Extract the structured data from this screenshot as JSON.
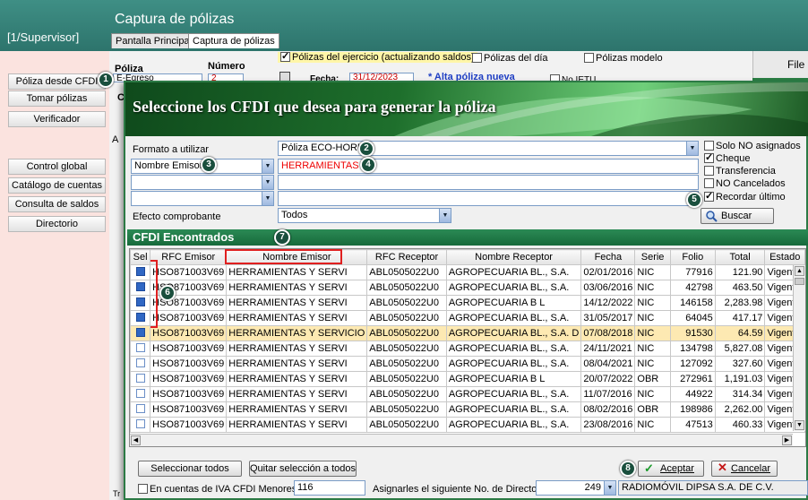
{
  "app": {
    "title": "Captura de pólizas",
    "user": "[1/Supervisor]"
  },
  "tabs": [
    "Pantalla Principal",
    "Captura de pólizas"
  ],
  "sidebar": {
    "items": [
      "Póliza desde CFDI",
      "Tomar pólizas",
      "Verificador",
      "Control global",
      "Catálogo de cuentas",
      "Consulta de saldos",
      "Directorio"
    ]
  },
  "background_form": {
    "poliza_label": "Póliza",
    "numero_label": "Número",
    "poliza_value": "E-Egreso",
    "numero_value": "2",
    "fecha_label": "Fecha:",
    "fecha_value": "31/12/2023",
    "alta_link": "* Alta póliza nueva",
    "no_ietu": "No IETU",
    "checks": [
      {
        "label": "Pólizas del ejercicio (actualizando saldos)",
        "checked": true
      },
      {
        "label": "Pólizas del día",
        "checked": false
      },
      {
        "label": "Pólizas modelo",
        "checked": false
      }
    ],
    "file_menu": "File",
    "left_letter_c": "C",
    "left_letter_a": "A",
    "bottom_letter": "Tr"
  },
  "dialog": {
    "title": "Seleccione los CFDI que desea para generar la póliza",
    "formato_label": "Formato a utilizar",
    "formato_value": "Póliza ECO-HORU",
    "filter1_field": "Nombre Emisor",
    "filter1_value": "HERRAMIENTAS",
    "efecto_label": "Efecto comprobante",
    "efecto_value": "Todos",
    "options": [
      {
        "label": "Solo NO asignados",
        "checked": false
      },
      {
        "label": "Cheque",
        "checked": true
      },
      {
        "label": "Transferencia",
        "checked": false
      },
      {
        "label": "NO Cancelados",
        "checked": false
      },
      {
        "label": "Recordar último",
        "checked": true
      }
    ],
    "buscar_label": "Buscar",
    "cfdi_header": "CFDI Encontrados",
    "columns": [
      "Sel",
      "RFC Emisor",
      "Nombre Emisor",
      "RFC Receptor",
      "Nombre Receptor",
      "Fecha",
      "Serie",
      "Folio",
      "Total",
      "Estado"
    ],
    "rows": [
      {
        "sel": true,
        "rfc_emisor": "HSO871003V69",
        "nombre_emisor": "HERRAMIENTAS Y SERVI",
        "rfc_receptor": "ABL0505022U0",
        "nombre_receptor": "AGROPECUARIA BL., S.A.",
        "fecha": "02/01/2016",
        "serie": "NIC",
        "folio": "77916",
        "total": "121.90",
        "estado": "Vigente"
      },
      {
        "sel": true,
        "rfc_emisor": "HSO871003V69",
        "nombre_emisor": "HERRAMIENTAS Y SERVI",
        "rfc_receptor": "ABL0505022U0",
        "nombre_receptor": "AGROPECUARIA BL., S.A.",
        "fecha": "03/06/2016",
        "serie": "NIC",
        "folio": "42798",
        "total": "463.50",
        "estado": "Vigente"
      },
      {
        "sel": true,
        "rfc_emisor": "HSO871003V69",
        "nombre_emisor": "HERRAMIENTAS Y SERVI",
        "rfc_receptor": "ABL0505022U0",
        "nombre_receptor": "AGROPECUARIA B L",
        "fecha": "14/12/2022",
        "serie": "NIC",
        "folio": "146158",
        "total": "2,283.98",
        "estado": "Vigente"
      },
      {
        "sel": true,
        "rfc_emisor": "HSO871003V69",
        "nombre_emisor": "HERRAMIENTAS Y SERVI",
        "rfc_receptor": "ABL0505022U0",
        "nombre_receptor": "AGROPECUARIA BL., S.A.",
        "fecha": "31/05/2017",
        "serie": "NIC",
        "folio": "64045",
        "total": "417.17",
        "estado": "Vigente"
      },
      {
        "sel": true,
        "rfc_emisor": "HSO871003V69",
        "nombre_emisor": "HERRAMIENTAS Y SERVICIO",
        "rfc_receptor": "ABL0505022U0",
        "nombre_receptor": "AGROPECUARIA BL., S.A. D",
        "fecha": "07/08/2018",
        "serie": "NIC",
        "folio": "91530",
        "total": "64.59",
        "estado": "Vigente",
        "highlight": true
      },
      {
        "sel": false,
        "rfc_emisor": "HSO871003V69",
        "nombre_emisor": "HERRAMIENTAS Y SERVI",
        "rfc_receptor": "ABL0505022U0",
        "nombre_receptor": "AGROPECUARIA BL., S.A.",
        "fecha": "24/11/2021",
        "serie": "NIC",
        "folio": "134798",
        "total": "5,827.08",
        "estado": "Vigente"
      },
      {
        "sel": false,
        "rfc_emisor": "HSO871003V69",
        "nombre_emisor": "HERRAMIENTAS Y SERVI",
        "rfc_receptor": "ABL0505022U0",
        "nombre_receptor": "AGROPECUARIA BL., S.A.",
        "fecha": "08/04/2021",
        "serie": "NIC",
        "folio": "127092",
        "total": "327.60",
        "estado": "Vigente"
      },
      {
        "sel": false,
        "rfc_emisor": "HSO871003V69",
        "nombre_emisor": "HERRAMIENTAS Y SERVI",
        "rfc_receptor": "ABL0505022U0",
        "nombre_receptor": "AGROPECUARIA B L",
        "fecha": "20/07/2022",
        "serie": "OBR",
        "folio": "272961",
        "total": "1,191.03",
        "estado": "Vigente"
      },
      {
        "sel": false,
        "rfc_emisor": "HSO871003V69",
        "nombre_emisor": "HERRAMIENTAS Y SERVI",
        "rfc_receptor": "ABL0505022U0",
        "nombre_receptor": "AGROPECUARIA BL., S.A.",
        "fecha": "11/07/2016",
        "serie": "NIC",
        "folio": "44922",
        "total": "314.34",
        "estado": "Vigente"
      },
      {
        "sel": false,
        "rfc_emisor": "HSO871003V69",
        "nombre_emisor": "HERRAMIENTAS Y SERVI",
        "rfc_receptor": "ABL0505022U0",
        "nombre_receptor": "AGROPECUARIA BL., S.A.",
        "fecha": "08/02/2016",
        "serie": "OBR",
        "folio": "198986",
        "total": "2,262.00",
        "estado": "Vigente"
      },
      {
        "sel": false,
        "rfc_emisor": "HSO871003V69",
        "nombre_emisor": "HERRAMIENTAS Y SERVI",
        "rfc_receptor": "ABL0505022U0",
        "nombre_receptor": "AGROPECUARIA BL., S.A.",
        "fecha": "23/08/2016",
        "serie": "NIC",
        "folio": "47513",
        "total": "460.33",
        "estado": "Vigente"
      }
    ],
    "select_all": "Seleccionar todos",
    "clear_all": "Quitar selección a todos",
    "aceptar": "Aceptar",
    "cancelar": "Cancelar",
    "iva_label": "En cuentas de IVA CFDI Menores a:",
    "iva_value": "116",
    "dir_label": "Asignarles el siguiente No. de Directorio",
    "dir_value": "249",
    "dir_name": "RADIOMÓVIL DIPSA S.A. DE C.V."
  },
  "badges": [
    "1",
    "2",
    "3",
    "4",
    "5",
    "6",
    "7",
    "8"
  ]
}
